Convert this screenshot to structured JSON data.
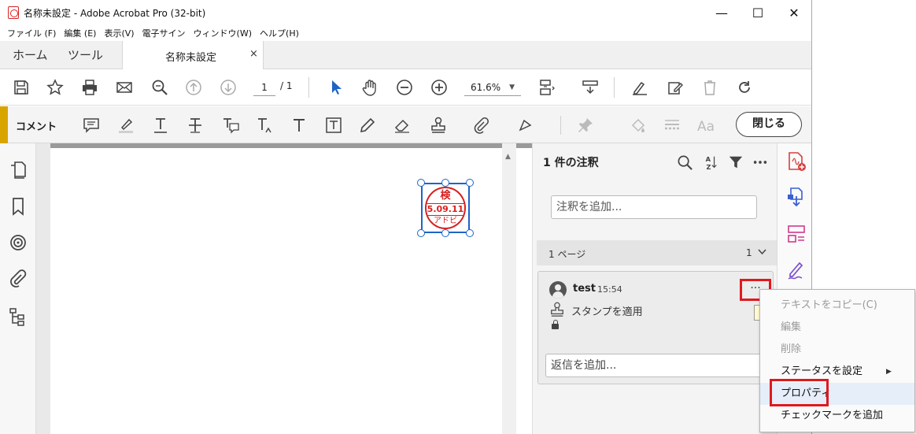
{
  "window": {
    "title": "名称未設定 - Adobe Acrobat Pro (32-bit)",
    "controls": [
      "—",
      "☐",
      "✕"
    ]
  },
  "menubar": [
    "ファイル (F)",
    "編集 (E)",
    "表示(V)",
    "電子サイン",
    "ウィンドウ(W)",
    "ヘルプ(H)"
  ],
  "tabs": {
    "home": "ホーム",
    "tools": "ツール",
    "document": "名称未設定",
    "close": "×"
  },
  "toolbar": {
    "page_current": "1",
    "page_total": "/  1",
    "zoom": "61.6%",
    "icons": [
      "save-icon",
      "star-icon",
      "print-icon",
      "mail-icon",
      "zoom-search-icon",
      "page-up-icon",
      "page-down-icon",
      "select-arrow-icon",
      "hand-icon",
      "zoom-out-icon",
      "zoom-in-icon",
      "fit-page-icon",
      "scroll-mode-icon",
      "sign-icon",
      "edit-icon",
      "trash-icon",
      "rotate-icon"
    ]
  },
  "comment_toolbar": {
    "label": "コメント",
    "close_label": "閉じる",
    "icons": [
      "sticky-note-icon",
      "highlight-icon",
      "underline-text-icon",
      "strikethrough-icon",
      "replace-text-icon",
      "insert-text-icon",
      "add-text-icon",
      "text-box-icon",
      "pencil-icon",
      "eraser-icon",
      "stamp-icon",
      "attach-icon",
      "shapes-icon",
      "pin-icon",
      "fill-icon",
      "lines-icon",
      "font-size-icon"
    ]
  },
  "stamp": {
    "top": "検",
    "date": "5.09.11",
    "bottom": "アドビ"
  },
  "comments_panel": {
    "title": "1 件の注釈",
    "add_placeholder": "注釈を追加...",
    "page_header": "1 ページ",
    "page_count": "1",
    "card": {
      "user": "test",
      "time": "15:54",
      "description": "スタンプを適用",
      "more": "···",
      "reply_placeholder": "返信を追加..."
    }
  },
  "context_menu": {
    "items": [
      {
        "label": "テキストをコピー(C)",
        "disabled": true
      },
      {
        "label": "編集",
        "disabled": true
      },
      {
        "label": "削除",
        "disabled": true
      },
      {
        "label": "ステータスを設定",
        "disabled": false,
        "submenu": true
      },
      {
        "label": "プロパティ",
        "disabled": false,
        "highlighted": true
      },
      {
        "label": "チェックマークを追加",
        "disabled": false
      }
    ]
  },
  "colors": {
    "accent_red": "#e0191f",
    "stamp_red": "#d82020",
    "selection_blue": "#1e64c8",
    "comment_bar_accent": "#d9a400"
  }
}
